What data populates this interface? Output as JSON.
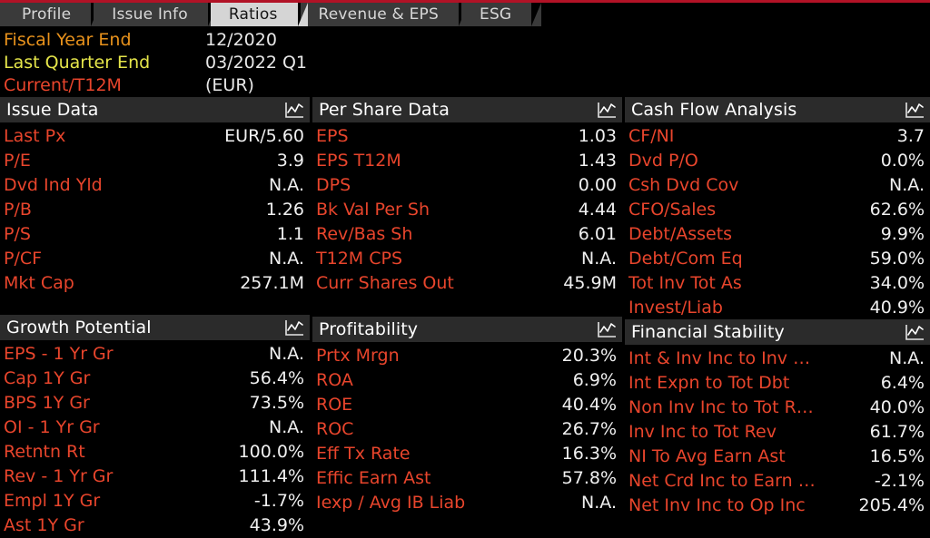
{
  "tabs": [
    {
      "label": "Profile",
      "active": false
    },
    {
      "label": "Issue Info",
      "active": false
    },
    {
      "label": "Ratios",
      "active": true
    },
    {
      "label": "Revenue & EPS",
      "active": false
    },
    {
      "label": "ESG",
      "active": false
    }
  ],
  "summary": [
    {
      "label": "Fiscal Year End",
      "value": "12/2020",
      "label_color": "#e8921c"
    },
    {
      "label": "Last Quarter End",
      "value": "03/2022 Q1",
      "label_color": "#e5e54a"
    },
    {
      "label": "Current/T12M",
      "value": "(EUR)",
      "label_color": "#e8452c"
    }
  ],
  "icons": {
    "chart": "line-chart-icon"
  },
  "colors": {
    "accent_red": "#b11226",
    "label_red": "#e8452c",
    "value_white": "#f0f0f0",
    "panel_header_bg": "#2b2b2b",
    "tab_active_bg": "#d5d5d5",
    "tab_inactive_bg": "#3a3a3a",
    "background": "#000000"
  },
  "panels": [
    {
      "title": "Issue Data",
      "column": 1,
      "rows": [
        {
          "label": "Last Px",
          "value": "EUR/5.60"
        },
        {
          "label": "P/E",
          "value": "3.9"
        },
        {
          "label": "Dvd Ind Yld",
          "value": "N.A."
        },
        {
          "label": "P/B",
          "value": "1.26"
        },
        {
          "label": "P/S",
          "value": "1.1"
        },
        {
          "label": "P/CF",
          "value": "N.A."
        },
        {
          "label": "Mkt Cap",
          "value": "257.1M"
        }
      ]
    },
    {
      "title": "Growth Potential",
      "column": 1,
      "rows": [
        {
          "label": "EPS - 1 Yr Gr",
          "value": "N.A."
        },
        {
          "label": "Cap 1Y Gr",
          "value": "56.4%"
        },
        {
          "label": "BPS 1Y Gr",
          "value": "73.5%"
        },
        {
          "label": "OI - 1 Yr Gr",
          "value": "N.A."
        },
        {
          "label": "Retntn Rt",
          "value": "100.0%"
        },
        {
          "label": "Rev - 1 Yr Gr",
          "value": "111.4%"
        },
        {
          "label": "Empl 1Y Gr",
          "value": "-1.7%"
        },
        {
          "label": "Ast 1Y Gr",
          "value": "43.9%"
        }
      ]
    },
    {
      "title": "Per Share Data",
      "column": 2,
      "rows": [
        {
          "label": "EPS",
          "value": "1.03"
        },
        {
          "label": "EPS T12M",
          "value": "1.43"
        },
        {
          "label": "DPS",
          "value": "0.00"
        },
        {
          "label": "Bk Val Per Sh",
          "value": "4.44"
        },
        {
          "label": "Rev/Bas Sh",
          "value": "6.01"
        },
        {
          "label": "T12M CPS",
          "value": "N.A."
        },
        {
          "label": "Curr Shares Out",
          "value": "45.9M"
        }
      ]
    },
    {
      "title": "Profitability",
      "column": 2,
      "rows": [
        {
          "label": "Prtx Mrgn",
          "value": "20.3%"
        },
        {
          "label": "ROA",
          "value": "6.9%"
        },
        {
          "label": "ROE",
          "value": "40.4%"
        },
        {
          "label": "ROC",
          "value": "26.7%"
        },
        {
          "label": "Eff Tx Rate",
          "value": "16.3%"
        },
        {
          "label": "Effic Earn Ast",
          "value": "57.8%"
        },
        {
          "label": "Iexp / Avg IB Liab",
          "value": "N.A."
        }
      ]
    },
    {
      "title": "Cash Flow Analysis",
      "column": 3,
      "rows": [
        {
          "label": "CF/NI",
          "value": "3.7"
        },
        {
          "label": "Dvd P/O",
          "value": "0.0%"
        },
        {
          "label": "Csh Dvd Cov",
          "value": "N.A."
        },
        {
          "label": "CFO/Sales",
          "value": "62.6%"
        },
        {
          "label": "Debt/Assets",
          "value": "9.9%"
        },
        {
          "label": "Debt/Com Eq",
          "value": "59.0%"
        },
        {
          "label": "Tot Inv Tot As",
          "value": "34.0%"
        },
        {
          "label": "Invest/Liab",
          "value": "40.9%"
        }
      ]
    },
    {
      "title": "Financial Stability",
      "column": 3,
      "rows": [
        {
          "label": "Int & Inv Inc to Inv …",
          "value": "N.A."
        },
        {
          "label": "Int Expn to Tot Dbt",
          "value": "6.4%"
        },
        {
          "label": "Non Inv Inc to Tot R…",
          "value": "40.0%"
        },
        {
          "label": "Inv Inc to Tot Rev",
          "value": "61.7%"
        },
        {
          "label": "NI To Avg Earn Ast",
          "value": "16.5%"
        },
        {
          "label": "Net Crd Inc to Earn …",
          "value": "-2.1%"
        },
        {
          "label": "Net Inv Inc to Op Inc",
          "value": "205.4%"
        }
      ]
    }
  ]
}
